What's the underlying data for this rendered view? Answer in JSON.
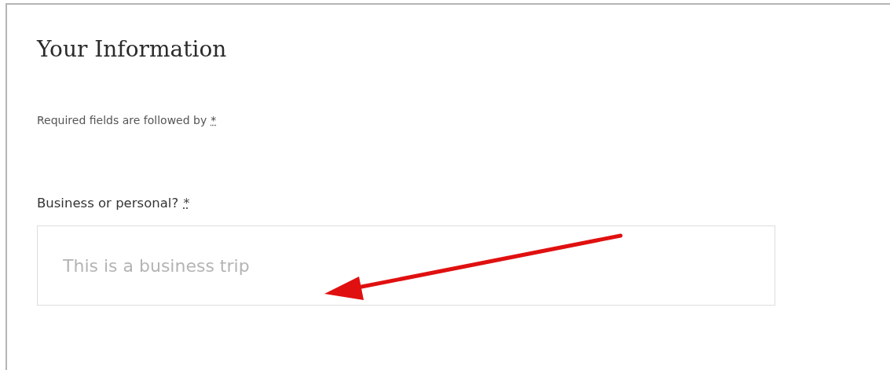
{
  "heading": "Your Information",
  "note": {
    "text": "Required fields are followed by",
    "mark": "*"
  },
  "field": {
    "label": "Business or personal?",
    "required_mark": "*",
    "placeholder": "This is a business trip"
  }
}
